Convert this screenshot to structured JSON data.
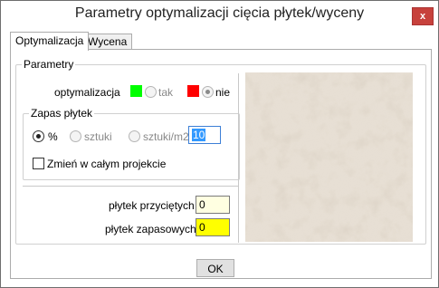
{
  "window": {
    "title": "Parametry optymalizacji cięcia płytek/wyceny",
    "close_label": "x"
  },
  "tabs": [
    {
      "label": "Optymalizacja",
      "active": true
    },
    {
      "label": "Wycena",
      "active": false
    }
  ],
  "parametry": {
    "legend": "Parametry",
    "optymalizacja_label": "optymalizacja",
    "option_tak": {
      "label": "tak",
      "swatch_color": "#00ff00",
      "checked": false,
      "enabled": false
    },
    "option_nie": {
      "label": "nie",
      "swatch_color": "#ff0000",
      "checked": true,
      "enabled": false
    }
  },
  "zapas": {
    "legend": "Zapas płytek",
    "options": [
      {
        "label": "%",
        "checked": true,
        "enabled": true
      },
      {
        "label": "sztuki",
        "checked": false,
        "enabled": false
      },
      {
        "label": "sztuki/m2",
        "checked": false,
        "enabled": false
      }
    ],
    "value": "10",
    "checkbox_label": "Zmień w całym projekcie",
    "checkbox_checked": false
  },
  "counts": {
    "cut_label": "płytek przyciętych",
    "cut_value": "0",
    "cut_bg": "#ffffe1",
    "spare_label": "płytek zapasowych",
    "spare_value": "0",
    "spare_bg": "#ffff00"
  },
  "preview": {
    "texture_color": "#e7dfd4"
  },
  "footer": {
    "ok_label": "OK"
  }
}
